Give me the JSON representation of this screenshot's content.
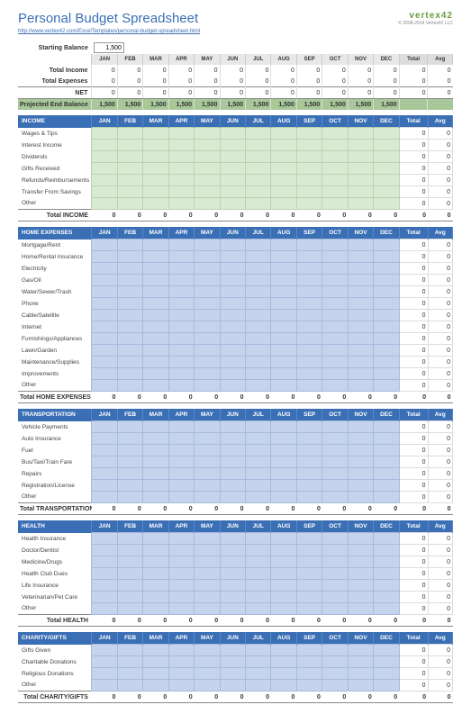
{
  "title": "Personal Budget Spreadsheet",
  "source_url": "http://www.vertex42.com/ExcelTemplates/personal-budget-spreadsheet.html",
  "logo": "vertex42",
  "copyright": "© 2008-2014 Vertex42 LLC",
  "starting_balance_label": "Starting Balance",
  "starting_balance": "1,500",
  "months": [
    "JAN",
    "FEB",
    "MAR",
    "APR",
    "MAY",
    "JUN",
    "JUL",
    "AUG",
    "SEP",
    "OCT",
    "NOV",
    "DEC"
  ],
  "total_label": "Total",
  "avg_label": "Avg",
  "summary": {
    "total_income_label": "Total Income",
    "total_income": [
      "0",
      "0",
      "0",
      "0",
      "0",
      "0",
      "0",
      "0",
      "0",
      "0",
      "0",
      "0",
      "0",
      "0"
    ],
    "total_expenses_label": "Total Expenses",
    "total_expenses": [
      "0",
      "0",
      "0",
      "0",
      "0",
      "0",
      "0",
      "0",
      "0",
      "0",
      "0",
      "0",
      "0",
      "0"
    ],
    "net_label": "NET",
    "net": [
      "0",
      "0",
      "0",
      "0",
      "0",
      "0",
      "0",
      "0",
      "0",
      "0",
      "0",
      "0",
      "0",
      "0"
    ],
    "projected_label": "Projected End Balance",
    "projected": [
      "1,500",
      "1,500",
      "1,500",
      "1,500",
      "1,500",
      "1,500",
      "1,500",
      "1,500",
      "1,500",
      "1,500",
      "1,500",
      "1,500"
    ]
  },
  "sections": [
    {
      "name": "INCOME",
      "style": "green-sect",
      "total_label": "Total INCOME",
      "categories": [
        "Wages & Tips",
        "Interest Income",
        "Dividends",
        "Gifts Received",
        "Refunds/Reimbursements",
        "Transfer From Savings",
        "Other"
      ],
      "totals": [
        "0",
        "0",
        "0",
        "0",
        "0",
        "0",
        "0"
      ],
      "avgs": [
        "0",
        "0",
        "0",
        "0",
        "0",
        "0",
        "0"
      ],
      "section_total": [
        "0",
        "0",
        "0",
        "0",
        "0",
        "0",
        "0",
        "0",
        "0",
        "0",
        "0",
        "0",
        "0",
        "0"
      ]
    },
    {
      "name": "HOME EXPENSES",
      "style": "blue-sect",
      "total_label": "Total HOME EXPENSES",
      "categories": [
        "Mortgage/Rent",
        "Home/Rental Insurance",
        "Electricity",
        "Gas/Oil",
        "Water/Sewer/Trash",
        "Phone",
        "Cable/Satellite",
        "Internet",
        "Furnishings/Appliances",
        "Lawn/Garden",
        "Maintenance/Supplies",
        "Improvements",
        "Other"
      ],
      "totals": [
        "0",
        "0",
        "0",
        "0",
        "0",
        "0",
        "0",
        "0",
        "0",
        "0",
        "0",
        "0",
        "0"
      ],
      "avgs": [
        "0",
        "0",
        "0",
        "0",
        "0",
        "0",
        "0",
        "0",
        "0",
        "0",
        "0",
        "0",
        "0"
      ],
      "section_total": [
        "0",
        "0",
        "0",
        "0",
        "0",
        "0",
        "0",
        "0",
        "0",
        "0",
        "0",
        "0",
        "0",
        "0"
      ]
    },
    {
      "name": "TRANSPORTATION",
      "style": "blue-sect",
      "total_label": "Total TRANSPORTATION",
      "categories": [
        "Vehicle Payments",
        "Auto Insurance",
        "Fuel",
        "Bus/Taxi/Train Fare",
        "Repairs",
        "Registration/License",
        "Other"
      ],
      "totals": [
        "0",
        "0",
        "0",
        "0",
        "0",
        "0",
        "0"
      ],
      "avgs": [
        "0",
        "0",
        "0",
        "0",
        "0",
        "0",
        "0"
      ],
      "section_total": [
        "0",
        "0",
        "0",
        "0",
        "0",
        "0",
        "0",
        "0",
        "0",
        "0",
        "0",
        "0",
        "0",
        "0"
      ]
    },
    {
      "name": "HEALTH",
      "style": "blue-sect",
      "total_label": "Total HEALTH",
      "categories": [
        "Health Insurance",
        "Doctor/Dentist",
        "Medicine/Drugs",
        "Health Club Dues",
        "Life Insurance",
        "Veterinarian/Pet Care",
        "Other"
      ],
      "totals": [
        "0",
        "0",
        "0",
        "0",
        "0",
        "0",
        "0"
      ],
      "avgs": [
        "0",
        "0",
        "0",
        "0",
        "0",
        "0",
        "0"
      ],
      "section_total": [
        "0",
        "0",
        "0",
        "0",
        "0",
        "0",
        "0",
        "0",
        "0",
        "0",
        "0",
        "0",
        "0",
        "0"
      ]
    },
    {
      "name": "CHARITY/GIFTS",
      "style": "blue-sect",
      "total_label": "Total CHARITY/GIFTS",
      "categories": [
        "Gifts Given",
        "Charitable Donations",
        "Religious Donations",
        "Other"
      ],
      "totals": [
        "0",
        "0",
        "0",
        "0"
      ],
      "avgs": [
        "0",
        "0",
        "0",
        "0"
      ],
      "section_total": [
        "0",
        "0",
        "0",
        "0",
        "0",
        "0",
        "0",
        "0",
        "0",
        "0",
        "0",
        "0",
        "0",
        "0"
      ]
    }
  ]
}
